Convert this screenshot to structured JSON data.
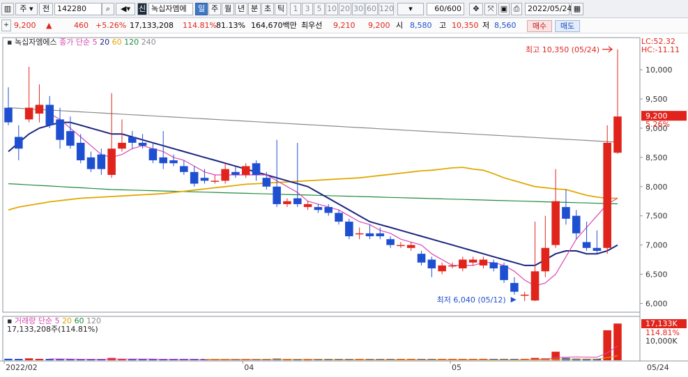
{
  "toolbar": {
    "market": "주",
    "jeon": "전",
    "code": "142280",
    "badge": "신",
    "name": "녹십자엠에",
    "periods": [
      "일",
      "주",
      "월",
      "년",
      "분",
      "초",
      "틱"
    ],
    "active_period": "일",
    "numbers": [
      "1",
      "3",
      "5",
      "10",
      "20",
      "30",
      "60",
      "120"
    ],
    "count": "60/600",
    "date": "2022/05/24"
  },
  "quote": {
    "price": "9,200",
    "arrow": "▲",
    "change": "460",
    "change_pct": "+5.26%",
    "volume": "17,133,208",
    "vol_ratio": "114.81%",
    "ratio2": "81.13%",
    "amount": "164,670백만",
    "best_label": "최우선",
    "best_ask": "9,210",
    "best_bid": "9,200",
    "open_label": "시",
    "open": "8,580",
    "high_label": "고",
    "high": "10,350",
    "low_label": "저",
    "low": "8,560",
    "buy": "매수",
    "sell": "매도"
  },
  "colors": {
    "up": "#e0241c",
    "down": "#1f4fd1",
    "ma5": "#d946b0",
    "ma20": "#1a237e",
    "ma60": "#e0a800",
    "ma120": "#1e8a3e",
    "ma240": "#8a8a8a"
  },
  "chart_data": {
    "type": "candlestick",
    "legend_name": "녹십자엠에스",
    "legend_price": "종가 단순",
    "ma_periods": [
      "5",
      "20",
      "60",
      "120",
      "240"
    ],
    "right_top": [
      "LC:52.32",
      "HC:-11.11"
    ],
    "y_ticks": [
      "10,000",
      "9,500",
      "9,000",
      "8,500",
      "8,000",
      "7,500",
      "7,000",
      "6,500",
      "6,000"
    ],
    "y_values": [
      10000,
      9500,
      9000,
      8500,
      8000,
      7500,
      7000,
      6500,
      6000
    ],
    "last_price": "9,200",
    "last_pct": "5.26%",
    "high_note": "최고 10,350 (05/24)",
    "low_note": "최저 6,040 (05/12)",
    "x_labels": [
      "2022/02",
      "04",
      "05",
      "05/24"
    ],
    "candles": [
      {
        "o": 9350,
        "c": 9100,
        "h": 9700,
        "l": 9050
      },
      {
        "o": 8850,
        "c": 8650,
        "h": 9050,
        "l": 8450
      },
      {
        "o": 9150,
        "c": 9350,
        "h": 10050,
        "l": 9100
      },
      {
        "o": 9250,
        "c": 9400,
        "h": 9750,
        "l": 9100
      },
      {
        "o": 9400,
        "c": 9050,
        "h": 9550,
        "l": 9000
      },
      {
        "o": 9150,
        "c": 8800,
        "h": 9350,
        "l": 8650
      },
      {
        "o": 8950,
        "c": 8700,
        "h": 9200,
        "l": 8650
      },
      {
        "o": 8750,
        "c": 8450,
        "h": 8900,
        "l": 8400
      },
      {
        "o": 8500,
        "c": 8300,
        "h": 8600,
        "l": 8250
      },
      {
        "o": 8550,
        "c": 8300,
        "h": 8650,
        "l": 8200
      },
      {
        "o": 8200,
        "c": 8650,
        "h": 9600,
        "l": 8150
      },
      {
        "o": 8650,
        "c": 8750,
        "h": 9150,
        "l": 8600
      },
      {
        "o": 8850,
        "c": 8750,
        "h": 8950,
        "l": 8650
      },
      {
        "o": 8750,
        "c": 8700,
        "h": 8900,
        "l": 8650
      },
      {
        "o": 8650,
        "c": 8450,
        "h": 8750,
        "l": 8400
      },
      {
        "o": 8500,
        "c": 8400,
        "h": 8950,
        "l": 8300
      },
      {
        "o": 8450,
        "c": 8400,
        "h": 8550,
        "l": 8350
      },
      {
        "o": 8350,
        "c": 8250,
        "h": 8450,
        "l": 8200
      },
      {
        "o": 8250,
        "c": 8050,
        "h": 8350,
        "l": 8000
      },
      {
        "o": 8150,
        "c": 8100,
        "h": 8300,
        "l": 8050
      },
      {
        "o": 8100,
        "c": 8100,
        "h": 8200,
        "l": 8050
      },
      {
        "o": 8100,
        "c": 8300,
        "h": 8400,
        "l": 8050
      },
      {
        "o": 8250,
        "c": 8200,
        "h": 8350,
        "l": 8150
      },
      {
        "o": 8200,
        "c": 8350,
        "h": 8400,
        "l": 8150
      },
      {
        "o": 8400,
        "c": 8200,
        "h": 8450,
        "l": 8100
      },
      {
        "o": 8150,
        "c": 8000,
        "h": 8250,
        "l": 7950
      },
      {
        "o": 8000,
        "c": 7700,
        "h": 8800,
        "l": 7650
      },
      {
        "o": 7700,
        "c": 7750,
        "h": 7800,
        "l": 7650
      },
      {
        "o": 7800,
        "c": 7700,
        "h": 8750,
        "l": 7650
      },
      {
        "o": 7650,
        "c": 7700,
        "h": 7750,
        "l": 7600
      },
      {
        "o": 7650,
        "c": 7600,
        "h": 7700,
        "l": 7550
      },
      {
        "o": 7650,
        "c": 7550,
        "h": 7700,
        "l": 7500
      },
      {
        "o": 7550,
        "c": 7400,
        "h": 7600,
        "l": 7350
      },
      {
        "o": 7400,
        "c": 7150,
        "h": 7450,
        "l": 7100
      },
      {
        "o": 7200,
        "c": 7200,
        "h": 7300,
        "l": 7100
      },
      {
        "o": 7200,
        "c": 7150,
        "h": 7350,
        "l": 7100
      },
      {
        "o": 7200,
        "c": 7150,
        "h": 7300,
        "l": 7100
      },
      {
        "o": 7100,
        "c": 7000,
        "h": 7150,
        "l": 6950
      },
      {
        "o": 7000,
        "c": 7000,
        "h": 7050,
        "l": 6950
      },
      {
        "o": 6950,
        "c": 7000,
        "h": 7050,
        "l": 6900
      },
      {
        "o": 6850,
        "c": 6700,
        "h": 6900,
        "l": 6650
      },
      {
        "o": 6750,
        "c": 6600,
        "h": 6800,
        "l": 6450
      },
      {
        "o": 6550,
        "c": 6650,
        "h": 6700,
        "l": 6500
      },
      {
        "o": 6650,
        "c": 6650,
        "h": 6700,
        "l": 6600
      },
      {
        "o": 6600,
        "c": 6750,
        "h": 6800,
        "l": 6550
      },
      {
        "o": 6700,
        "c": 6750,
        "h": 6800,
        "l": 6650
      },
      {
        "o": 6650,
        "c": 6750,
        "h": 6800,
        "l": 6600
      },
      {
        "o": 6700,
        "c": 6600,
        "h": 6750,
        "l": 6550
      },
      {
        "o": 6650,
        "c": 6400,
        "h": 6700,
        "l": 6350
      },
      {
        "o": 6350,
        "c": 6200,
        "h": 6450,
        "l": 6150
      },
      {
        "o": 6150,
        "c": 6150,
        "h": 6200,
        "l": 6040
      },
      {
        "o": 6050,
        "c": 6550,
        "h": 7400,
        "l": 6040
      },
      {
        "o": 6550,
        "c": 6950,
        "h": 7500,
        "l": 6450
      },
      {
        "o": 7000,
        "c": 7750,
        "h": 8300,
        "l": 6950
      },
      {
        "o": 7650,
        "c": 7450,
        "h": 7950,
        "l": 7350
      },
      {
        "o": 7500,
        "c": 7200,
        "h": 7600,
        "l": 7100
      },
      {
        "o": 7050,
        "c": 6950,
        "h": 7400,
        "l": 6900
      },
      {
        "o": 6950,
        "c": 6900,
        "h": 7250,
        "l": 6850
      },
      {
        "o": 6950,
        "c": 8750,
        "h": 9050,
        "l": 6850
      },
      {
        "o": 8580,
        "c": 9200,
        "h": 10350,
        "l": 8560
      }
    ],
    "ma5": [
      null,
      null,
      null,
      null,
      9250,
      9150,
      9000,
      8850,
      8700,
      8550,
      8500,
      8550,
      8650,
      8700,
      8650,
      8600,
      8500,
      8450,
      8350,
      8250,
      8200,
      8200,
      8200,
      8200,
      8200,
      8200,
      8100,
      8000,
      7900,
      7750,
      7700,
      7650,
      7600,
      7500,
      7400,
      7350,
      7250,
      7200,
      7100,
      7050,
      7000,
      6850,
      6750,
      6650,
      6650,
      6650,
      6700,
      6700,
      6650,
      6550,
      6400,
      6300,
      6350,
      6500,
      6800,
      7100,
      7300,
      7500,
      7700,
      7800
    ],
    "ma20": [
      8600,
      8750,
      8900,
      9000,
      9050,
      9100,
      9100,
      9050,
      9000,
      8950,
      8900,
      8900,
      8850,
      8800,
      8750,
      8700,
      8650,
      8600,
      8550,
      8500,
      8450,
      8400,
      8350,
      8300,
      8250,
      8200,
      8150,
      8100,
      8050,
      8000,
      7900,
      7800,
      7700,
      7600,
      7500,
      7400,
      7350,
      7300,
      7250,
      7200,
      7150,
      7100,
      7050,
      7000,
      6950,
      6900,
      6850,
      6800,
      6750,
      6700,
      6650,
      6650,
      6750,
      6850,
      6900,
      6900,
      6850,
      6850,
      6900,
      7000
    ],
    "ma60": [
      7600,
      7650,
      7680,
      7710,
      7740,
      7760,
      7780,
      7800,
      7810,
      7820,
      7830,
      7840,
      7850,
      7860,
      7870,
      7880,
      7900,
      7920,
      7940,
      7960,
      7980,
      8000,
      8020,
      8040,
      8050,
      8060,
      8070,
      8080,
      8090,
      8100,
      8110,
      8120,
      8130,
      8140,
      8150,
      8170,
      8190,
      8210,
      8230,
      8250,
      8270,
      8280,
      8300,
      8320,
      8330,
      8300,
      8280,
      8220,
      8150,
      8100,
      8050,
      8000,
      7980,
      7960,
      7950,
      7900,
      7850,
      7820,
      7800,
      7800
    ],
    "ma120": [
      8050,
      8040,
      8030,
      8020,
      8010,
      8000,
      7990,
      7980,
      7970,
      7960,
      7950,
      7945,
      7940,
      7935,
      7930,
      7925,
      7920,
      7915,
      7910,
      7905,
      7900,
      7895,
      7890,
      7885,
      7880,
      7875,
      7870,
      7865,
      7860,
      7855,
      7850,
      7845,
      7840,
      7835,
      7830,
      7825,
      7820,
      7815,
      7810,
      7805,
      7800,
      7795,
      7790,
      7785,
      7780,
      7775,
      7770,
      7765,
      7760,
      7755,
      7750,
      7745,
      7740,
      7735,
      7730,
      7725,
      7720,
      7715,
      7710,
      7705
    ],
    "ma240": [
      9350,
      9340,
      9330,
      9320,
      9310,
      9300,
      9290,
      9280,
      9270,
      9260,
      9250,
      9240,
      9230,
      9220,
      9210,
      9200,
      9190,
      9180,
      9170,
      9160,
      9150,
      9140,
      9130,
      9120,
      9110,
      9100,
      9090,
      9080,
      9070,
      9060,
      9050,
      9040,
      9030,
      9020,
      9010,
      9000,
      8990,
      8980,
      8970,
      8960,
      8950,
      8940,
      8930,
      8920,
      8910,
      8900,
      8890,
      8880,
      8870,
      8860,
      8850,
      8840,
      8830,
      8820,
      8810,
      8800,
      8790,
      8780,
      8770,
      8760
    ],
    "volume_legend": {
      "name": "거래량",
      "type": "단순",
      "periods": [
        "5",
        "20",
        "60",
        "120"
      ],
      "value": "17,133,208주(114.81%)"
    },
    "volume_axis": {
      "last": "17,133K",
      "pct": "114.81%",
      "tick": "10,000K"
    },
    "volumes": [
      700,
      600,
      900,
      500,
      600,
      500,
      500,
      400,
      400,
      500,
      1100,
      600,
      400,
      300,
      300,
      400,
      300,
      300,
      300,
      200,
      200,
      300,
      200,
      300,
      200,
      200,
      800,
      300,
      600,
      200,
      200,
      200,
      200,
      300,
      200,
      200,
      200,
      150,
      150,
      150,
      200,
      200,
      150,
      150,
      150,
      150,
      150,
      150,
      200,
      200,
      200,
      1100,
      900,
      4000,
      1100,
      800,
      700,
      700,
      14000,
      17133
    ]
  }
}
